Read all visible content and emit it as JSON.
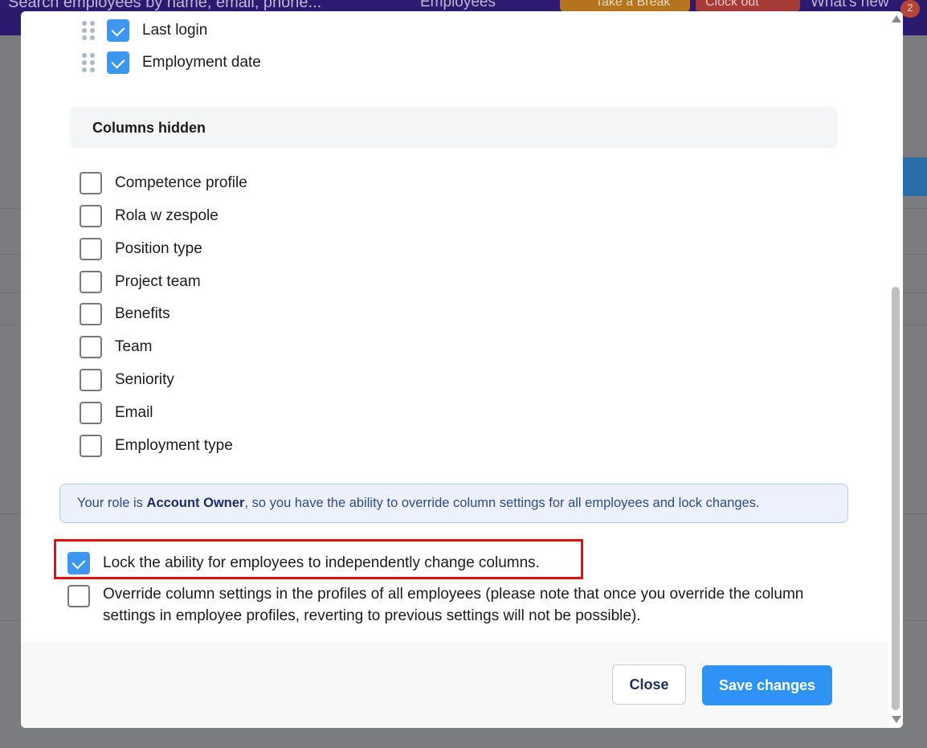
{
  "background": {
    "search_placeholder": "Search employees by name, email, phone...",
    "nav_employees": "Employees",
    "take_break": "Take a Break",
    "clock_out": "Clock out",
    "whats_new": "What's new",
    "whats_new_badge": "2"
  },
  "modal": {
    "visible_columns": [
      {
        "label": "Last login",
        "checked": true
      },
      {
        "label": "Employment date",
        "checked": true
      }
    ],
    "hidden_section_title": "Columns hidden",
    "hidden_columns": [
      {
        "label": "Competence profile",
        "checked": false
      },
      {
        "label": "Rola w zespole",
        "checked": false
      },
      {
        "label": "Position type",
        "checked": false
      },
      {
        "label": "Project team",
        "checked": false
      },
      {
        "label": "Benefits",
        "checked": false
      },
      {
        "label": "Team",
        "checked": false
      },
      {
        "label": "Seniority",
        "checked": false
      },
      {
        "label": "Email",
        "checked": false
      },
      {
        "label": "Employment type",
        "checked": false
      }
    ],
    "info": {
      "prefix": "Your role is ",
      "role": "Account Owner",
      "suffix": ", so you have the ability to override column settings for all employees and lock changes."
    },
    "lock_option": {
      "label": "Lock the ability for employees to independently change columns.",
      "checked": true
    },
    "override_option": {
      "label": "Override column settings in the profiles of all employees (please note that once you override the column settings in employee profiles, reverting to previous settings will not be possible).",
      "checked": false
    },
    "close_label": "Close",
    "save_label": "Save changes"
  },
  "colors": {
    "accent": "#3d96f0",
    "save_button": "#2f93f5",
    "highlight_border": "#e3110e",
    "info_bg": "#ecf1fd"
  }
}
